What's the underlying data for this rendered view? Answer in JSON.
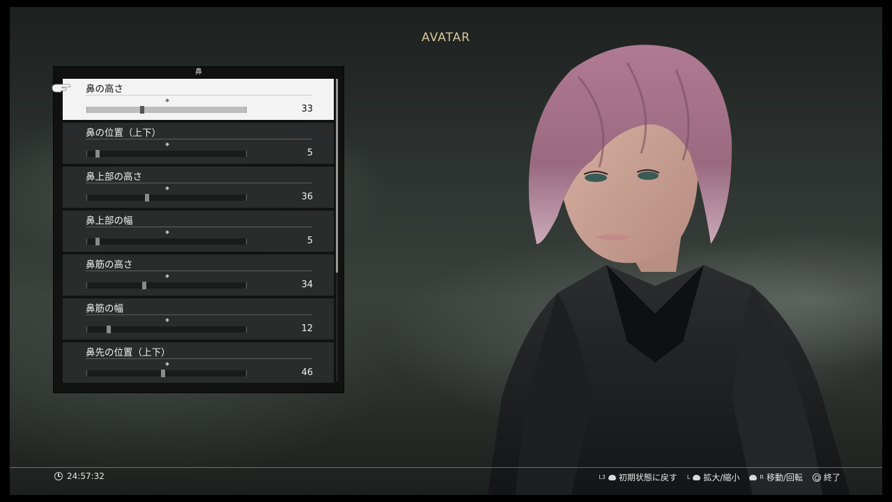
{
  "header": {
    "title": "AVATAR"
  },
  "panel": {
    "category": "鼻",
    "items": [
      {
        "label": "鼻の高さ",
        "value": "33",
        "level": 0.33,
        "selected": true
      },
      {
        "label": "鼻の位置（上下）",
        "value": "5",
        "level": 0.05,
        "selected": false
      },
      {
        "label": "鼻上部の高さ",
        "value": "36",
        "level": 0.36,
        "selected": false
      },
      {
        "label": "鼻上部の幅",
        "value": "5",
        "level": 0.05,
        "selected": false
      },
      {
        "label": "鼻筋の高さ",
        "value": "34",
        "level": 0.34,
        "selected": false
      },
      {
        "label": "鼻筋の幅",
        "value": "12",
        "level": 0.12,
        "selected": false
      },
      {
        "label": "鼻先の位置（上下）",
        "value": "46",
        "level": 0.46,
        "selected": false
      }
    ],
    "scroll_fraction_visible": 0.64
  },
  "footer": {
    "playtime": "24:57:32",
    "hints": {
      "reset_button": "L3",
      "reset_label": "初期状態に戻す",
      "zoom_button": "L",
      "zoom_label": "拡大/縮小",
      "move_button": "R",
      "move_label": "移動/回転",
      "exit_label": "終了"
    }
  },
  "colors": {
    "title": "#d9c79a",
    "selected_row": "#f3f3f3",
    "row": "#303232"
  },
  "icons": [
    "pointer-hand-icon",
    "clock-icon",
    "left-stick-icon",
    "right-stick-icon",
    "circle-button-icon"
  ]
}
